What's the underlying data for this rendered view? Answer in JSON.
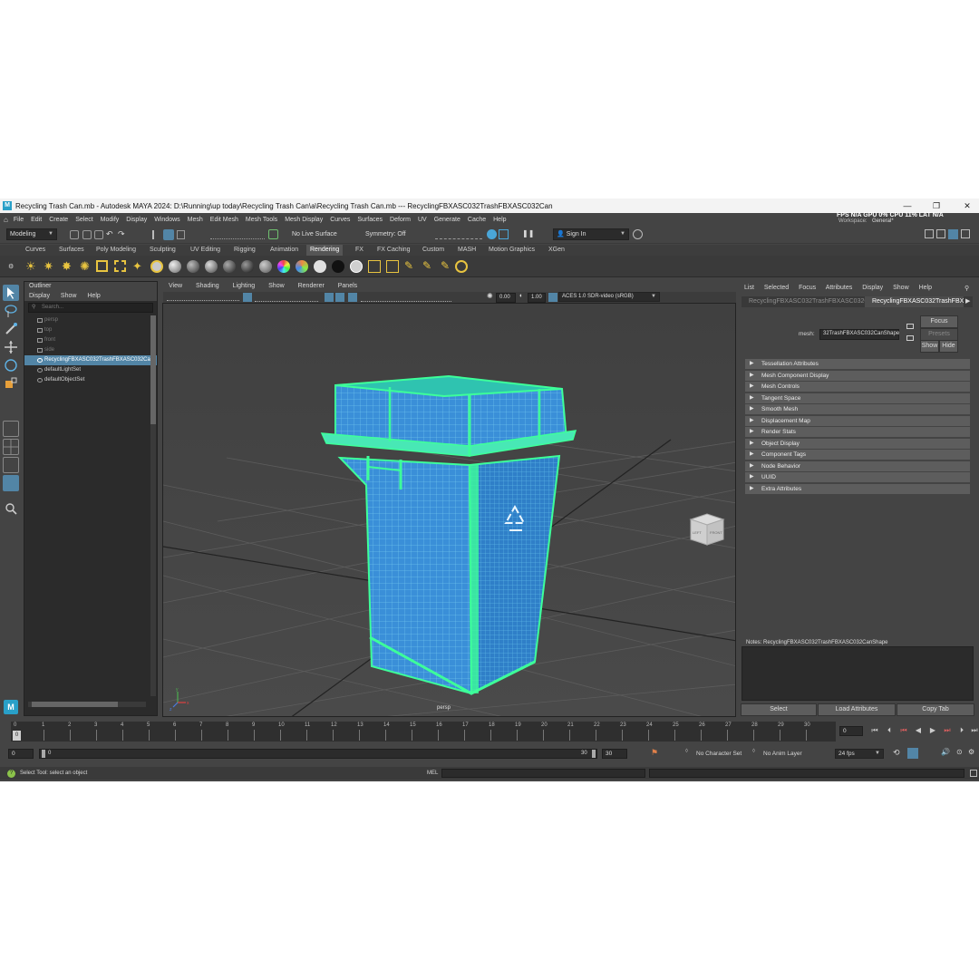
{
  "window": {
    "app_icon": "M",
    "title": "Recycling Trash Can.mb - Autodesk MAYA 2024: D:\\Running\\up today\\Recycling Trash Can\\a\\Recycling Trash Can.mb   ---   RecyclingFBXASC032TrashFBXASC032Can",
    "minimize": "—",
    "maximize": "❐",
    "close": "✕"
  },
  "menubar": {
    "items": [
      "File",
      "Edit",
      "Create",
      "Select",
      "Modify",
      "Display",
      "Windows",
      "Mesh",
      "Edit Mesh",
      "Mesh Tools",
      "Mesh Display",
      "Curves",
      "Surfaces",
      "Deform",
      "UV",
      "Generate",
      "Cache",
      "Help"
    ],
    "perf": "FPS  N/A  GPU  0%  CPU  11%  LAT  N/A",
    "workspace_label": "Workspace:",
    "workspace_value": "General*"
  },
  "statusline": {
    "mode": "Modeling",
    "live_surface": "No Live Surface",
    "symmetry": "Symmetry: Off",
    "sign_in": "Sign In"
  },
  "shelf": {
    "tabs": [
      "Curves",
      "Surfaces",
      "Poly Modeling",
      "Sculpting",
      "UV Editing",
      "Rigging",
      "Animation",
      "Rendering",
      "FX",
      "FX Caching",
      "Custom",
      "MASH",
      "Motion Graphics",
      "XGen"
    ],
    "active_tab": "Rendering"
  },
  "outliner": {
    "title": "Outliner",
    "menu": [
      "Display",
      "Show",
      "Help"
    ],
    "search_placeholder": "Search...",
    "items": [
      {
        "label": "persp",
        "dim": true
      },
      {
        "label": "top",
        "dim": true
      },
      {
        "label": "front",
        "dim": true
      },
      {
        "label": "side",
        "dim": true
      },
      {
        "label": "RecyclingFBXASC032TrashFBXASC032Can",
        "selected": true
      },
      {
        "label": "defaultLightSet"
      },
      {
        "label": "defaultObjectSet"
      }
    ]
  },
  "viewport": {
    "menu": [
      "View",
      "Shading",
      "Lighting",
      "Show",
      "Renderer",
      "Panels"
    ],
    "exposure": "0.00",
    "gamma": "1.00",
    "color_space": "ACES 1.0 SDR-video (sRGB)",
    "camera_label": "persp",
    "cube_left": "LEFT",
    "cube_front": "FRONT",
    "axis_x": "x",
    "axis_y": "y",
    "axis_z": "z"
  },
  "attribute_editor": {
    "menu": [
      "List",
      "Selected",
      "Focus",
      "Attributes",
      "Display",
      "Show",
      "Help"
    ],
    "tabs": [
      "RecyclingFBXASC032TrashFBXASC032Can",
      "RecyclingFBXASC032TrashFBXA"
    ],
    "active_tab": 1,
    "mesh_label": "mesh:",
    "mesh_value": "32TrashFBXASC032CanShape",
    "focus_button": "Focus",
    "presets_button": "Presets",
    "show_button": "Show",
    "hide_button": "Hide",
    "sections": [
      "Tessellation Attributes",
      "Mesh Component Display",
      "Mesh Controls",
      "Tangent Space",
      "Smooth Mesh",
      "Displacement Map",
      "Render Stats",
      "Object Display",
      "Component Tags",
      "Node Behavior",
      "UUID",
      "Extra Attributes"
    ],
    "notes_label": "Notes:  RecyclingFBXASC032TrashFBXASC032CanShape",
    "buttons": [
      "Select",
      "Load Attributes",
      "Copy Tab"
    ]
  },
  "timeline": {
    "ticks": [
      "1",
      "2",
      "3",
      "4",
      "5",
      "6",
      "7",
      "8",
      "9",
      "10",
      "11",
      "12",
      "13",
      "14",
      "15",
      "16",
      "17",
      "18",
      "19",
      "20",
      "21",
      "22",
      "23",
      "24",
      "25",
      "26",
      "27",
      "28",
      "29",
      "30"
    ],
    "start_marker": "0",
    "current_frame_marker": "0",
    "current_frame": "0"
  },
  "range": {
    "start": "0",
    "inner_start": "0",
    "inner_end": "30",
    "end": "30",
    "character_set": "No Character Set",
    "anim_layer": "No Anim Layer",
    "fps": "24 fps"
  },
  "helpline": {
    "text": "Select Tool: select an object",
    "mel_label": "MEL"
  },
  "colors": {
    "accent_selection": "#5285a6",
    "wireframe": "#3dff9a",
    "mesh_body": "#3a8fd8",
    "maya_blue": "#29a0c8"
  }
}
